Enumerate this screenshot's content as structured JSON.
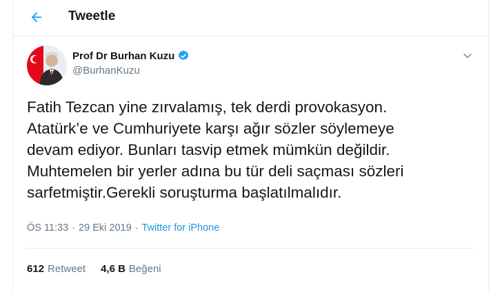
{
  "header": {
    "title": "Tweetle"
  },
  "author": {
    "name": "Prof Dr Burhan Kuzu",
    "handle": "@BurhanKuzu"
  },
  "tweet": {
    "lines": [
      "Fatih Tezcan yine zırvalamış, tek derdi provokasyon.",
      "Atatürk’e ve Cumhuriyete karşı ağır  sözler söylemeye",
      "devam ediyor. Bunları tasvip etmek mümkün değildir.",
      "Muhtemelen bir yerler adına bu tür deli saçması sözleri",
      "sarfetmiştir.Gerekli soruşturma başlatılmalıdır."
    ]
  },
  "meta": {
    "time": "ÖS 11:33",
    "sep1": "·",
    "date": "29 Eki 2019",
    "sep2": "·",
    "source": "Twitter for iPhone"
  },
  "stats": {
    "retweets_count": "612",
    "retweets_label": "Retweet",
    "likes_count": "4,6 B",
    "likes_label": "Beğeni"
  },
  "colors": {
    "accent": "#1da1f2",
    "muted": "#657786",
    "text": "#14171a",
    "flag_red": "#e30a17"
  },
  "icons": {
    "back": "arrow-left-icon",
    "verified": "verified-badge-icon",
    "menu": "chevron-down-icon"
  }
}
